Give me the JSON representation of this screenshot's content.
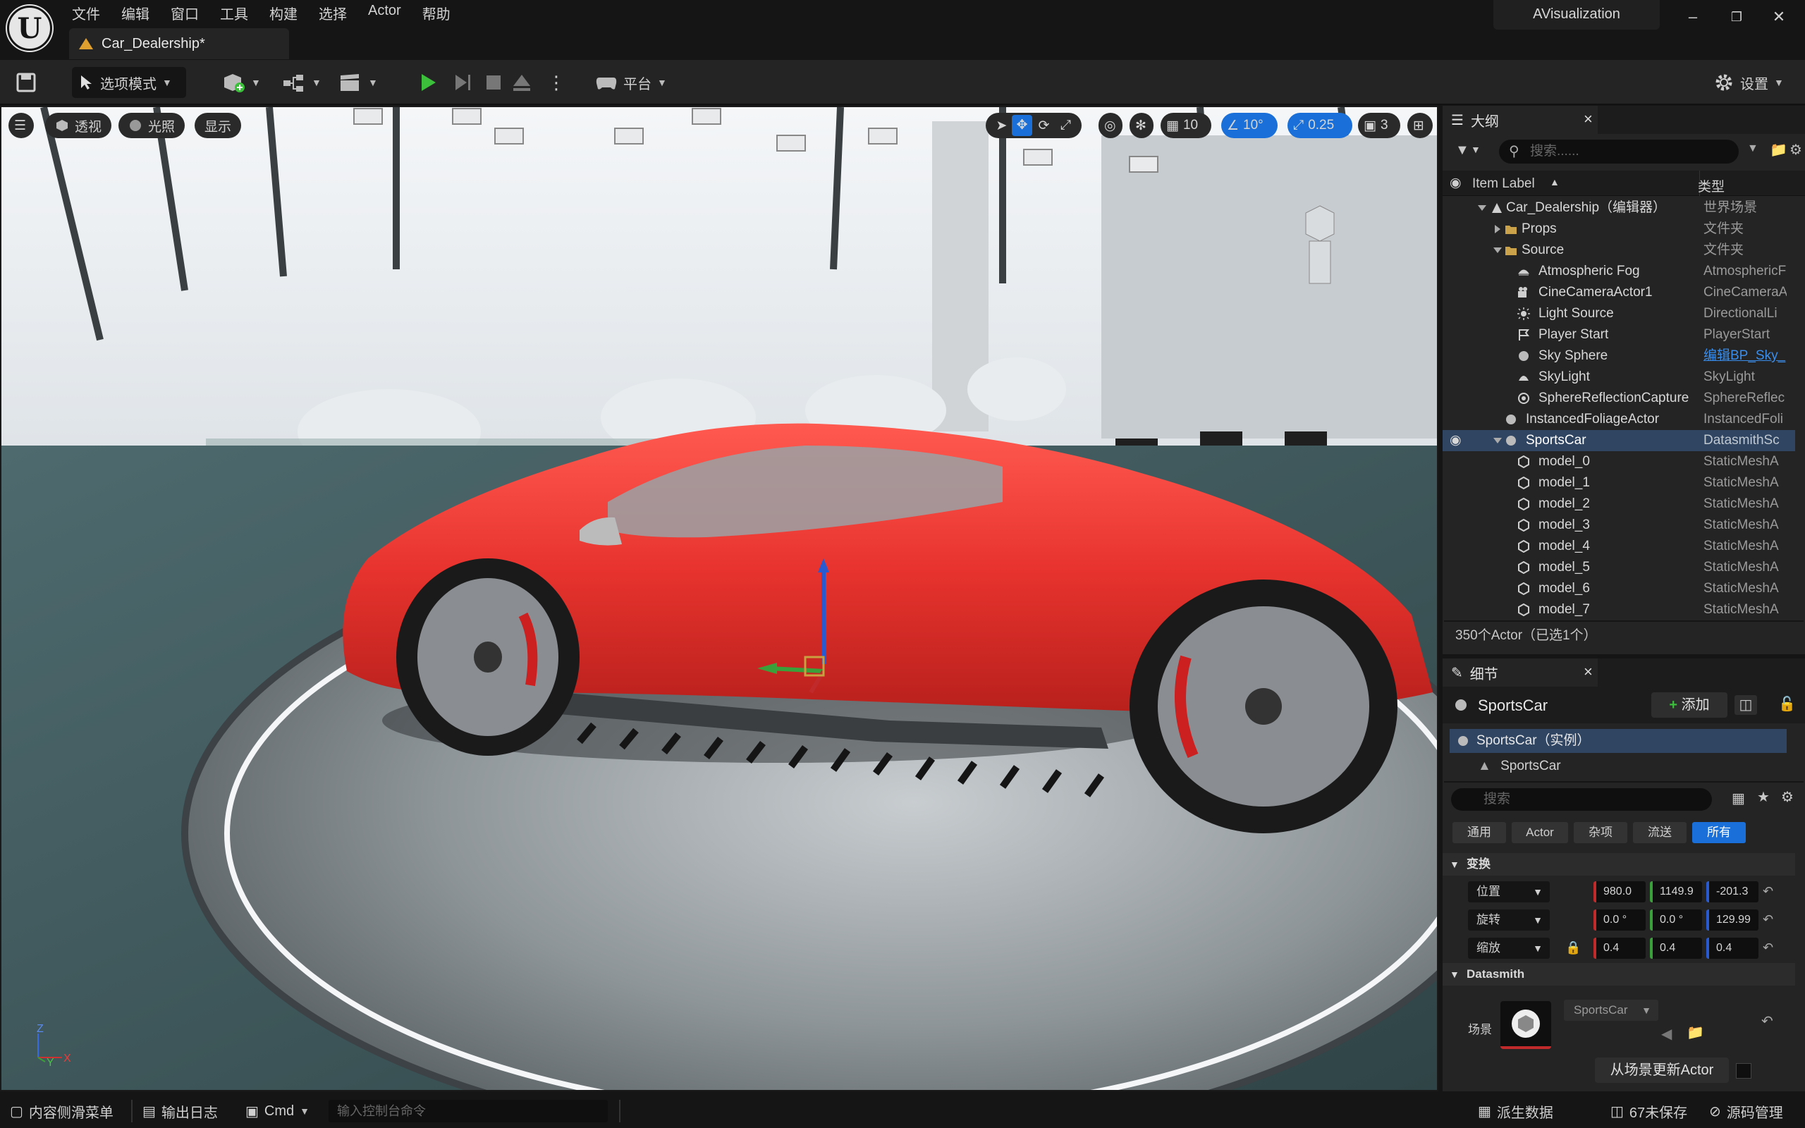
{
  "menubar": {
    "items": [
      "文件",
      "编辑",
      "窗口",
      "工具",
      "构建",
      "选择",
      "Actor",
      "帮助"
    ],
    "document_tab": "Car_Dealership*",
    "project": "AVisualization"
  },
  "toolbar": {
    "mode_label": "选项模式",
    "platform_label": "平台",
    "settings_label": "设置"
  },
  "viewport": {
    "perspective_label": "透视",
    "lighting_label": "光照",
    "show_label": "显示",
    "grid_value": "10",
    "rotation_value": "10°",
    "scale_value": "0.25",
    "camera_speed": "3",
    "axis_z": "Z",
    "axis_x": "X",
    "axis_y": "Y"
  },
  "outliner": {
    "tab_label": "大纲",
    "search_placeholder": "搜索......",
    "col_label": "Item Label",
    "col_type": "类型",
    "rows": [
      {
        "name": "Car_Dealership（编辑器）",
        "type": "世界场景"
      },
      {
        "name": "Props",
        "type": "文件夹"
      },
      {
        "name": "Source",
        "type": "文件夹"
      },
      {
        "name": "Atmospheric Fog",
        "type": "AtmosphericF"
      },
      {
        "name": "CineCameraActor1",
        "type": "CineCameraA"
      },
      {
        "name": "Light Source",
        "type": "DirectionalLi"
      },
      {
        "name": "Player Start",
        "type": "PlayerStart"
      },
      {
        "name": "Sky Sphere",
        "type": "编辑BP_Sky_"
      },
      {
        "name": "SkyLight",
        "type": "SkyLight"
      },
      {
        "name": "SphereReflectionCapture",
        "type": "SphereReflec"
      },
      {
        "name": "InstancedFoliageActor",
        "type": "InstancedFoli"
      },
      {
        "name": "SportsCar",
        "type": "DatasmithSc"
      },
      {
        "name": "model_0",
        "type": "StaticMeshA"
      },
      {
        "name": "model_1",
        "type": "StaticMeshA"
      },
      {
        "name": "model_2",
        "type": "StaticMeshA"
      },
      {
        "name": "model_3",
        "type": "StaticMeshA"
      },
      {
        "name": "model_4",
        "type": "StaticMeshA"
      },
      {
        "name": "model_5",
        "type": "StaticMeshA"
      },
      {
        "name": "model_6",
        "type": "StaticMeshA"
      },
      {
        "name": "model_7",
        "type": "StaticMeshA"
      }
    ],
    "actor_count": "350个Actor（已选1个）"
  },
  "details": {
    "tab_label": "细节",
    "actor_name": "SportsCar",
    "add_label": "添加",
    "component_root": "SportsCar（实例）",
    "component_child": "SportsCar",
    "search_placeholder": "搜索",
    "filters": [
      "通用",
      "Actor",
      "杂项",
      "流送",
      "所有"
    ],
    "transform_label": "变换",
    "location_label": "位置",
    "rotation_label": "旋转",
    "scale_label": "缩放",
    "location": [
      "980.0",
      "1149.9",
      "-201.3"
    ],
    "rotation": [
      "0.0 °",
      "0.0 °",
      "129.99"
    ],
    "scale": [
      "0.4",
      "0.4",
      "0.4"
    ],
    "datasmith_label": "Datasmith",
    "scene_label": "场景",
    "scene_value": "SportsCar",
    "update_label": "从场景更新Actor"
  },
  "statusbar": {
    "content_drawer": "内容侧滑菜单",
    "output_log": "输出日志",
    "cmd": "Cmd",
    "console_placeholder": "输入控制台命令",
    "derived_data": "派生数据",
    "unsaved": "67未保存",
    "source_control": "源码管理"
  },
  "colors": {
    "accent_blue": "#1a70d8",
    "selection": "#2f4562",
    "car_red": "#e8332e",
    "play_green": "#3cc03c"
  }
}
